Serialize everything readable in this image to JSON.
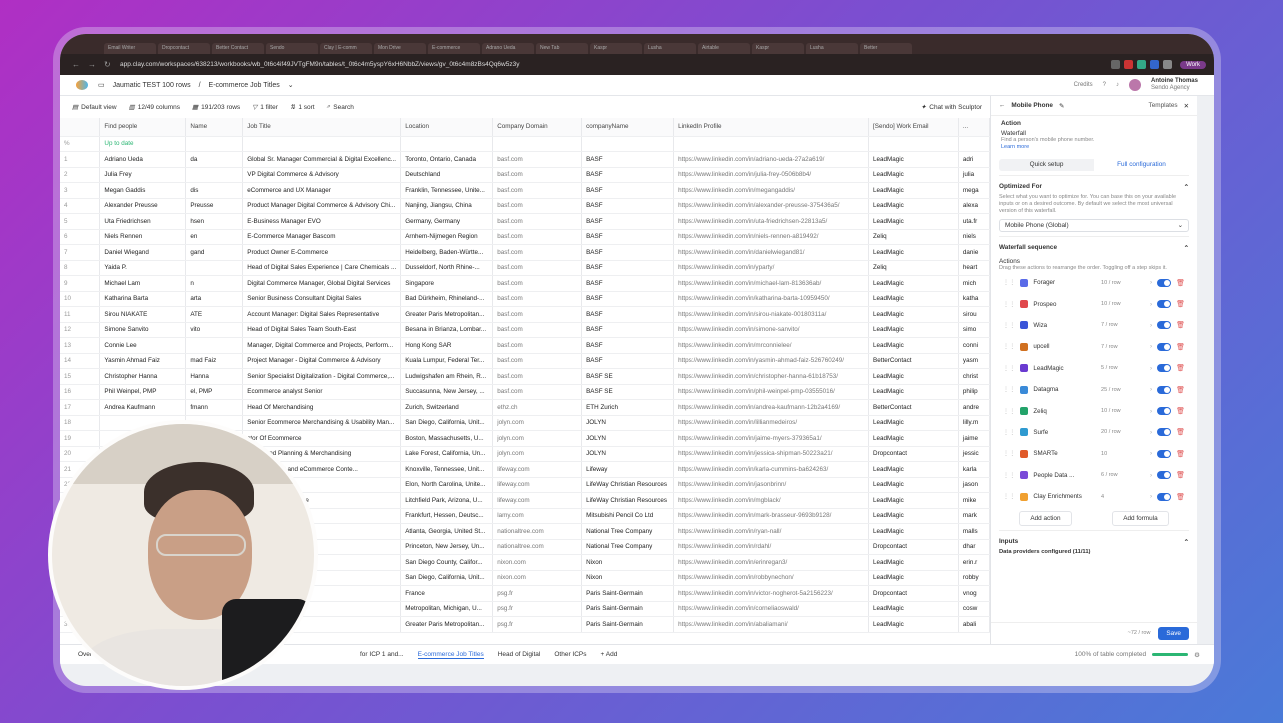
{
  "browser": {
    "tabs": [
      "Email Writer",
      "Dropcontact",
      "Better Contact",
      "Sendo",
      "Clay | E-comm",
      "Mon Drive",
      "E-commerce",
      "Adrano Ueda",
      "New Tab",
      "Kaspr",
      "Lusha",
      "Airtable",
      "Kaspr",
      "Lusha",
      "Better"
    ],
    "url": "app.clay.com/workspaces/638213/workbooks/wb_0t6c4if49JVTgFM9n/tables/t_0t6c4m5yspY6xH6NbbZ/views/gv_0t6c4m8zBs4Qq6w5z3y",
    "work_label": "Work"
  },
  "app": {
    "workbook": "Jaumatic TEST 100 rows",
    "table": "E-commerce Job Titles",
    "credits": "Credits",
    "user_name": "Antoine Thomas",
    "user_org": "Sendo Agency"
  },
  "toolbar": {
    "view": "Default view",
    "columns": "12/49 columns",
    "rows": "191/203 rows",
    "filter": "1 filter",
    "sort": "1 sort",
    "search": "Search",
    "sculptor": "Chat with Sculptor"
  },
  "grid": {
    "headers": [
      "",
      "Find people",
      "Name",
      "Job Title",
      "Location",
      "Company Domain",
      "companyName",
      "LinkedIn Profile",
      "[Sendo] Work Email",
      "..."
    ],
    "status_row": [
      "%",
      "Up to date",
      "",
      "",
      "",
      "",
      "",
      "",
      "",
      ""
    ],
    "rows": [
      [
        "1",
        "Adriano Ueda",
        "da",
        "Global Sr. Manager Commercial & Digital Excellenc...",
        "Toronto, Ontario, Canada",
        "basf.com",
        "BASF",
        "https://www.linkedin.com/in/adriano-ueda-27a2a619/",
        "LeadMagic",
        "adri"
      ],
      [
        "2",
        "Julia Frey",
        "",
        "VP Digital Commerce & Advisory",
        "Deutschland",
        "basf.com",
        "BASF",
        "https://www.linkedin.com/in/julia-frey-0506b8b4/",
        "LeadMagic",
        "julia"
      ],
      [
        "3",
        "Megan Gaddis",
        "dis",
        "eCommerce and UX Manager",
        "Franklin, Tennessee, Unite...",
        "basf.com",
        "BASF",
        "https://www.linkedin.com/in/megangaddis/",
        "LeadMagic",
        "mega"
      ],
      [
        "4",
        "Alexander Preusse",
        "Preusse",
        "Product Manager Digital Commerce & Advisory Chi...",
        "Nanjing, Jiangsu, China",
        "basf.com",
        "BASF",
        "https://www.linkedin.com/in/alexander-preusse-375436a5/",
        "LeadMagic",
        "alexa"
      ],
      [
        "5",
        "Uta Friedrichsen",
        "hsen",
        "E-Business Manager EVO",
        "Germany, Germany",
        "basf.com",
        "BASF",
        "https://www.linkedin.com/in/uta-friedrichsen-22813a5/",
        "LeadMagic",
        "uta.fr"
      ],
      [
        "6",
        "Niels Rennen",
        "en",
        "E-Commerce Manager Bascom",
        "Arnhem-Nijmegen Region",
        "basf.com",
        "BASF",
        "https://www.linkedin.com/in/niels-rennen-a819492/",
        "Zeliq",
        "niels"
      ],
      [
        "7",
        "Daniel Wiegand",
        "gand",
        "Product Owner E-Commerce",
        "Heidelberg, Baden-Württe...",
        "basf.com",
        "BASF",
        "https://www.linkedin.com/in/danielwiegand81/",
        "LeadMagic",
        "danie"
      ],
      [
        "8",
        "Yaida P.",
        "",
        "Head of Digital Sales Experience | Care Chemicals ...",
        "Dusseldorf, North Rhine-...",
        "basf.com",
        "BASF",
        "https://www.linkedin.com/in/yparty/",
        "Zeliq",
        "heart"
      ],
      [
        "9",
        "Michael Lam",
        "n",
        "Digital Commerce Manager, Global Digital Services",
        "Singapore",
        "basf.com",
        "BASF",
        "https://www.linkedin.com/in/michael-lam-813636ab/",
        "LeadMagic",
        "mich"
      ],
      [
        "10",
        "Katharina Barta",
        "arta",
        "Senior Business Consultant Digital Sales",
        "Bad Dürkheim, Rhineland-...",
        "basf.com",
        "BASF",
        "https://www.linkedin.com/in/katharina-barta-10959450/",
        "LeadMagic",
        "katha"
      ],
      [
        "11",
        "Sirou NIAKATE",
        "ATE",
        "Account Manager: Digital Sales Representative",
        "Greater Paris Metropolitan...",
        "basf.com",
        "BASF",
        "https://www.linkedin.com/in/sirou-niakate-00180311a/",
        "LeadMagic",
        "sirou"
      ],
      [
        "12",
        "Simone Sanvito",
        "vito",
        "Head of Digital Sales Team South-East",
        "Besana in Brianza, Lombar...",
        "basf.com",
        "BASF",
        "https://www.linkedin.com/in/simone-sanvito/",
        "LeadMagic",
        "simo"
      ],
      [
        "13",
        "Connie Lee",
        "",
        "Manager, Digital Commerce and Projects, Perform...",
        "Hong Kong SAR",
        "basf.com",
        "BASF",
        "https://www.linkedin.com/in/mrconnielee/",
        "LeadMagic",
        "conni"
      ],
      [
        "14",
        "Yasmin Ahmad Faiz",
        "mad Faiz",
        "Project Manager - Digital Commerce & Advisory",
        "Kuala Lumpur, Federal Ter...",
        "basf.com",
        "BASF",
        "https://www.linkedin.com/in/yasmin-ahmad-faiz-526760249/",
        "BetterContact",
        "yasm"
      ],
      [
        "15",
        "Christopher Hanna",
        "Hanna",
        "Senior Specialist Digitalization - Digital Commerce,...",
        "Ludwigshafen am Rhein, R...",
        "basf.com",
        "BASF SE",
        "https://www.linkedin.com/in/christopher-hanna-61b18753/",
        "LeadMagic",
        "christ"
      ],
      [
        "16",
        "Phil Weinpel, PMP",
        "el, PMP",
        "Ecommerce analyst Senior",
        "Succasunna, New Jersey, ...",
        "basf.com",
        "BASF SE",
        "https://www.linkedin.com/in/phil-weinpel-pmp-03555016/",
        "LeadMagic",
        "philip"
      ],
      [
        "17",
        "Andrea Kaufmann",
        "fmann",
        "Head Of Merchandising",
        "Zurich, Switzerland",
        "ethz.ch",
        "ETH Zurich",
        "https://www.linkedin.com/in/andrea-kaufmann-12b2a4169/",
        "BetterContact",
        "andre"
      ],
      [
        "18",
        "",
        "",
        "Senior Ecommerce Merchandising & Usability Man...",
        "San Diego, California, Unit...",
        "jolyn.com",
        "JOLYN",
        "https://www.linkedin.com/in/lillianmedeiros/",
        "LeadMagic",
        "lilly.m"
      ],
      [
        "19",
        "",
        "",
        "ctor Of Ecommerce",
        "Boston, Massachusetts, U...",
        "jolyn.com",
        "JOLYN",
        "https://www.linkedin.com/in/jaime-myers-379365a1/",
        "LeadMagic",
        "jaime"
      ],
      [
        "20",
        "",
        "",
        "r, Demand Planning & Merchandising",
        "Lake Forest, California, Un...",
        "jolyn.com",
        "JOLYN",
        "https://www.linkedin.com/in/jessica-shipman-50223a21/",
        "Dropcontact",
        "jessic"
      ],
      [
        "21",
        "",
        "",
        "ting Strategist and eCommerce Conte...",
        "Knoxville, Tennessee, Unit...",
        "lifeway.com",
        "Lifeway",
        "https://www.linkedin.com/in/karla-cummins-ba624263/",
        "LeadMagic",
        "karla"
      ],
      [
        "22",
        "",
        "",
        "& eCommerce",
        "Elon, North Carolina, Unite...",
        "lifeway.com",
        "LifeWay Christian Resources",
        "https://www.linkedin.com/in/jasonbrinn/",
        "LeadMagic",
        "jason"
      ],
      [
        "23",
        "",
        "",
        "keting & E-Commerce",
        "Litchfield Park, Arizona, U...",
        "lifeway.com",
        "LifeWay Christian Resources",
        "https://www.linkedin.com/in/mgblack/",
        "LeadMagic",
        "mike"
      ],
      [
        "24",
        "",
        "",
        "",
        "Frankfurt, Hessen, Deutsc...",
        "lamy.com",
        "Mitsubishi Pencil Co Ltd",
        "https://www.linkedin.com/in/mark-brasseur-9693b9128/",
        "LeadMagic",
        "mark"
      ],
      [
        "25",
        "",
        "",
        "ce Sales & Capabilities",
        "Atlanta, Georgia, United St...",
        "nationaltree.com",
        "National Tree Company",
        "https://www.linkedin.com/in/ryan-nall/",
        "LeadMagic",
        "malls"
      ],
      [
        "26",
        "",
        "",
        "st",
        "Princeton, New Jersey, Un...",
        "nationaltree.com",
        "National Tree Company",
        "https://www.linkedin.com/in/rdahl/",
        "Dropcontact",
        "dhar"
      ],
      [
        "27",
        "",
        "",
        "ger",
        "San Diego County, Califor...",
        "nixon.com",
        "Nixon",
        "https://www.linkedin.com/in/erinregan3/",
        "LeadMagic",
        "erin.r"
      ],
      [
        "28",
        "",
        "",
        "ce",
        "San Diego, California, Unit...",
        "nixon.com",
        "Nixon",
        "https://www.linkedin.com/in/robbynechon/",
        "LeadMagic",
        "robby"
      ],
      [
        "29",
        "",
        "",
        "rce project manager",
        "France",
        "psg.fr",
        "Paris Saint-Germain",
        "https://www.linkedin.com/in/victor-nogherot-5a2156223/",
        "Dropcontact",
        "vnog"
      ],
      [
        "30",
        "",
        "",
        "e & Product Manager",
        "Metropolitan, Michigan, U...",
        "psg.fr",
        "Paris Saint-Germain",
        "https://www.linkedin.com/in/corneliaoswald/",
        "LeadMagic",
        "cosw"
      ],
      [
        "31",
        "",
        "",
        "Commerce",
        "Greater Paris Metropolitan...",
        "psg.fr",
        "Paris Saint-Germain",
        "https://www.linkedin.com/in/abaliamani/",
        "LeadMagic",
        "abali"
      ]
    ]
  },
  "panel": {
    "title": "Mobile Phone",
    "templates": "Templates",
    "action_label": "Action",
    "action_name": "Waterfall",
    "action_desc": "Find a person's mobile phone number.",
    "learn_more": "Learn more",
    "tab_quick": "Quick setup",
    "tab_full": "Full configuration",
    "optimized_title": "Optimized For",
    "optimized_desc": "Select what you want to optimize for. You can base this on your available inputs or on a desired outcome. By default we select the most universal version of this waterfall.",
    "optimized_value": "Mobile Phone (Global)",
    "sequence_title": "Waterfall sequence",
    "actions_label": "Actions",
    "actions_desc": "Drag these actions to rearrange the order. Toggling off a step skips it.",
    "providers": [
      {
        "name": "Forager",
        "cost": "10 / row",
        "color": "#5a6be8"
      },
      {
        "name": "Prospeo",
        "cost": "10 / row",
        "color": "#e0484c"
      },
      {
        "name": "Wiza",
        "cost": "7 / row",
        "color": "#3a55d8"
      },
      {
        "name": "upcell",
        "cost": "7 / row",
        "color": "#d07020"
      },
      {
        "name": "LeadMagic",
        "cost": "5 / row",
        "color": "#6a3ad0"
      },
      {
        "name": "Datagma",
        "cost": "25 / row",
        "color": "#3a8ad8"
      },
      {
        "name": "Zeliq",
        "cost": "10 / row",
        "color": "#23a36a"
      },
      {
        "name": "Surfe",
        "cost": "20 / row",
        "color": "#2f9ad0"
      },
      {
        "name": "SMARTe",
        "cost": "10",
        "color": "#e05a2a"
      },
      {
        "name": "People Data ...",
        "cost": "6 / row",
        "color": "#7a4ad8"
      },
      {
        "name": "Clay Enrichments",
        "cost": "4",
        "color": "#f0a030"
      }
    ],
    "add_action": "Add action",
    "add_formula": "Add formula",
    "inputs_title": "Inputs",
    "inputs_desc": "Data providers configured (11/11)",
    "footer_cost": "~72 / row",
    "save": "Save"
  },
  "bottom": {
    "tabs": [
      "Over",
      "for ICP 1 and...",
      "E-commerce Job Titles",
      "Head of Digital",
      "Other ICPs"
    ],
    "add": "Add",
    "status": "100% of table completed"
  }
}
